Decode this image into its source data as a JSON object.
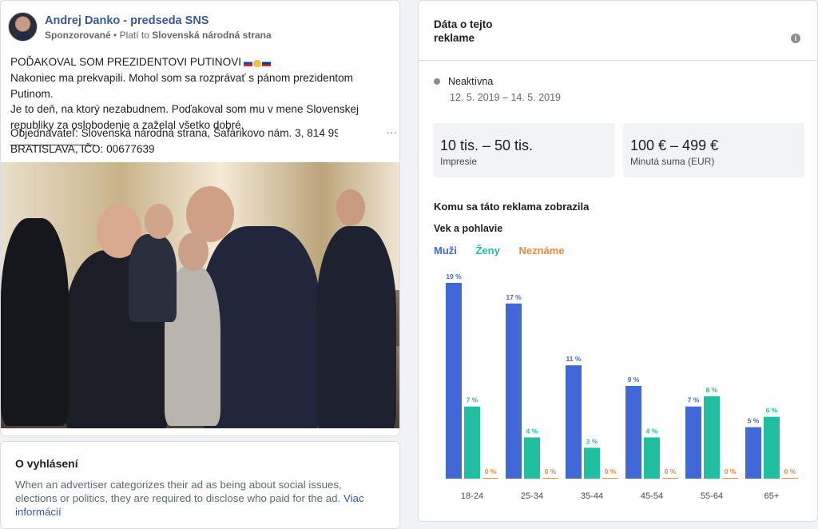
{
  "ad": {
    "page_name": "Andrej Danko - predseda SNS",
    "sponsored": "Sponzorované",
    "paid_by_prefix": "Platí to",
    "paid_by": "Slovenská národná strana",
    "headline": "POĎAKOVAL SOM PREZIDENTOVI PUTINOVI",
    "body_line1": "Nakoniec ma prekvapili. Mohol som sa rozprávať s pánom prezidentom Putinom.",
    "body_line2": "Je to deň, na ktorý nezabudnem. Poďakoval som mu v mene Slovenskej",
    "body_line3": "republiky za oslobodenie a zaželal všetko dobré.",
    "separator": "______________",
    "orderer_line1": "Objednávateľ: Slovenská národná strana, Šafárikovo nám. 3, 814 99",
    "orderer_line2": "BRATISLAVA, IČO: 00677639",
    "more": "..."
  },
  "about": {
    "title": "O vyhlásení",
    "body": "When an advertiser categorizes their ad as being about social issues, elections or politics, they are required to disclose who paid for the ad.",
    "link": "Viac informácií"
  },
  "panel": {
    "title": "Dáta o tejto reklame",
    "info_icon": "i",
    "status": "Neaktívna",
    "dates": "12. 5. 2019 – 14. 5. 2019",
    "impressions_value": "10 tis. – 50 tis.",
    "impressions_label": "Impresie",
    "spend_value": "100 € – 499 €",
    "spend_label": "Minutá suma (EUR)",
    "audience_title": "Komu sa táto reklama zobrazila",
    "age_gender_title": "Vek a pohlavie"
  },
  "chart_data": {
    "type": "bar",
    "categories": [
      "18-24",
      "25-34",
      "35-44",
      "45-54",
      "55-64",
      "65+"
    ],
    "series": [
      {
        "name": "Muži",
        "color": "#4267d6",
        "values": [
          19,
          17,
          11,
          9,
          7,
          5
        ]
      },
      {
        "name": "Ženy",
        "color": "#1fbf9f",
        "values": [
          7,
          4,
          3,
          4,
          8,
          6
        ]
      },
      {
        "name": "Neznáme",
        "color": "#f0883a",
        "values": [
          0,
          0,
          0,
          0,
          0,
          0
        ]
      }
    ],
    "unit": "%",
    "ylim": [
      0,
      19
    ]
  }
}
